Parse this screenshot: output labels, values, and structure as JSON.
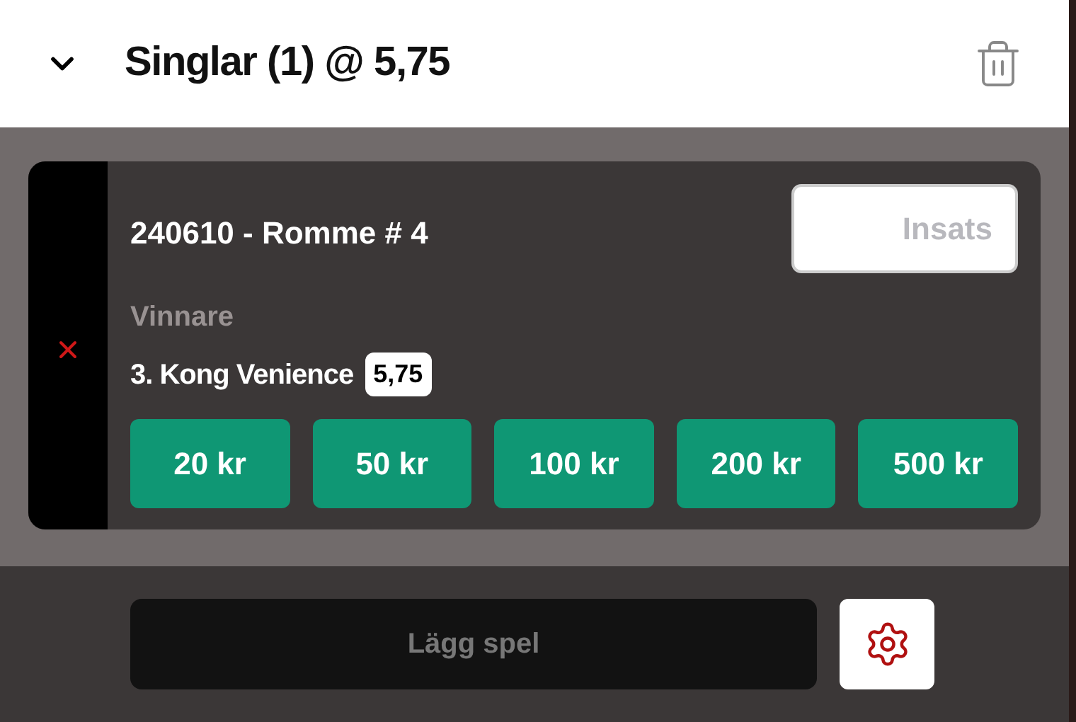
{
  "header": {
    "title": "Singlar (1) @ 5,75",
    "expanded": true
  },
  "bet": {
    "race": "240610 - Romme # 4",
    "stake": {
      "placeholder": "Insats"
    },
    "market": "Vinnare",
    "selection": "3. Kong Venience",
    "odds": "5,75",
    "amounts": [
      "20 kr",
      "50 kr",
      "100 kr",
      "200 kr",
      "500 kr"
    ]
  },
  "place_bet": {
    "label": "Lägg spel",
    "disabled": true
  }
}
